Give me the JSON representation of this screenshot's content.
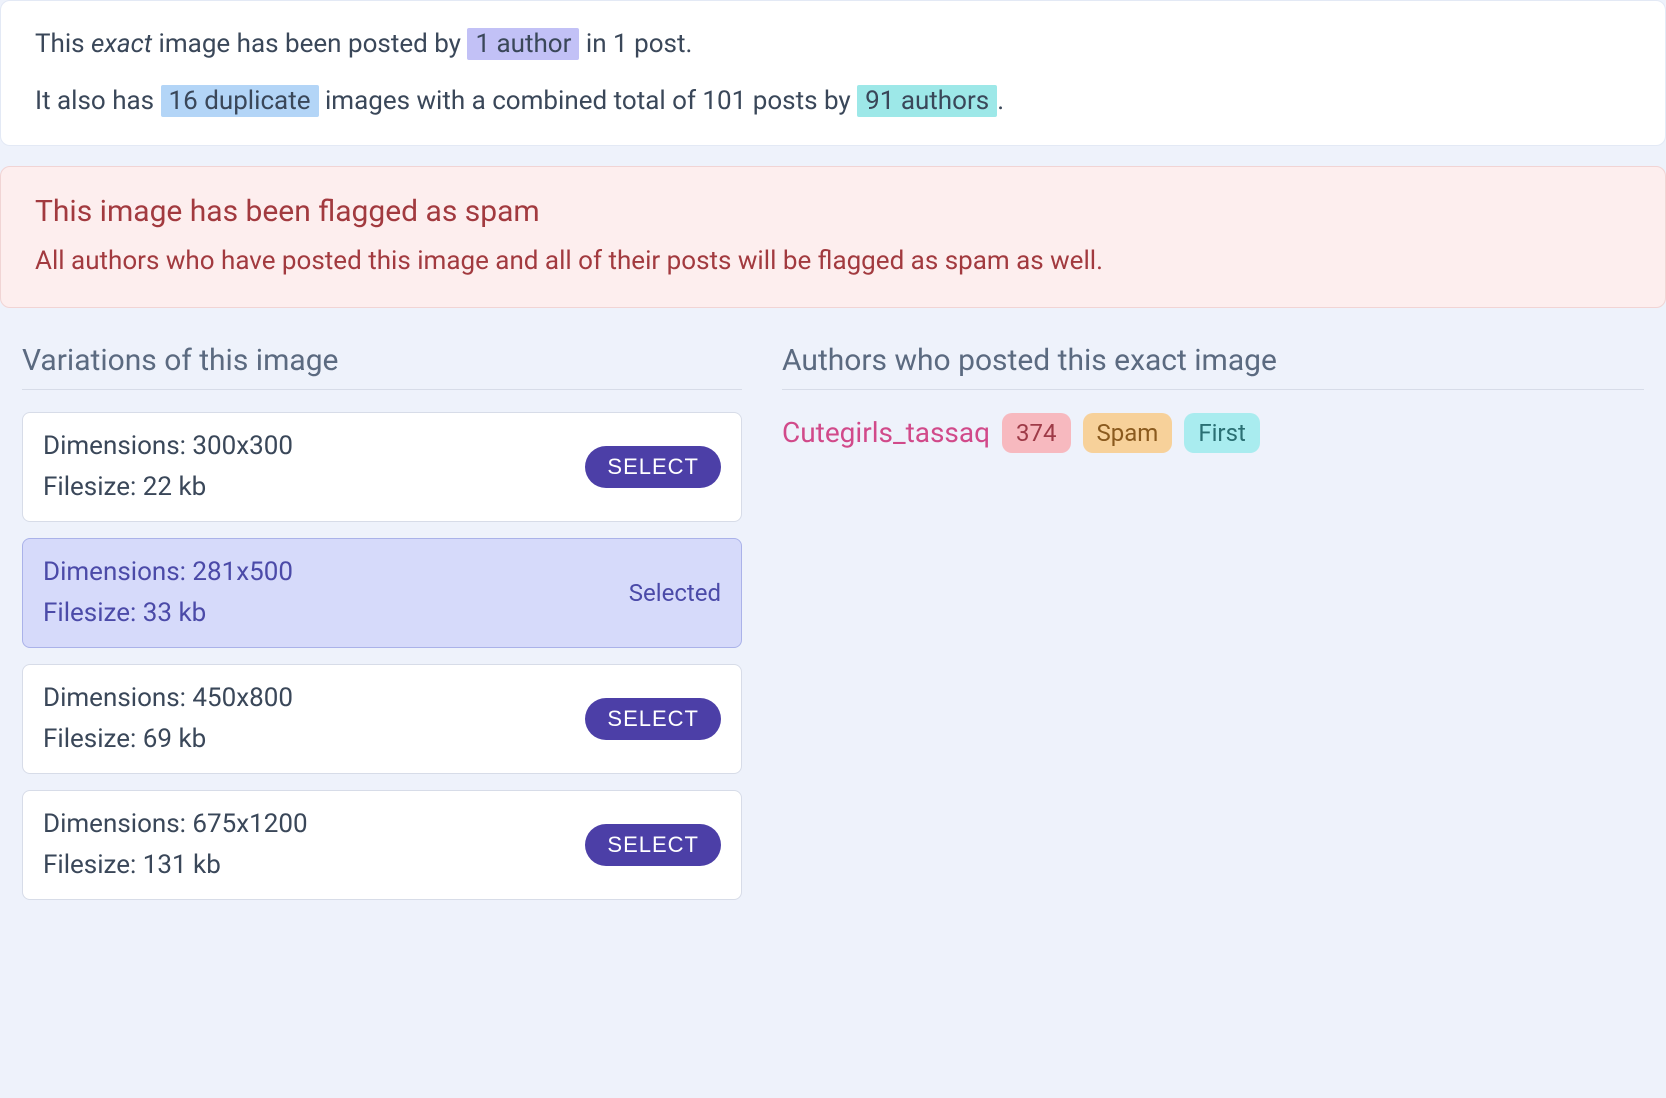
{
  "info": {
    "line1_prefix": "This ",
    "line1_exact": "exact",
    "line1_mid": " image has been posted by ",
    "line1_author_tag": "1 author",
    "line1_suffix": " in 1 post.",
    "line2_prefix": "It also has ",
    "line2_dup_tag": "16 duplicate",
    "line2_mid": " images with a combined total of 101 posts by ",
    "line2_auth_tag": "91 authors",
    "line2_suffix": "."
  },
  "alert": {
    "title": "This image has been flagged as spam",
    "body": "All authors who have posted this image and all of their posts will be flagged as spam as well."
  },
  "variations": {
    "heading": "Variations of this image",
    "select_label": "SELECT",
    "selected_label": "Selected",
    "items": [
      {
        "dimensions": "Dimensions: 300x300",
        "filesize": "Filesize: 22 kb",
        "selected": false
      },
      {
        "dimensions": "Dimensions: 281x500",
        "filesize": "Filesize: 33 kb",
        "selected": true
      },
      {
        "dimensions": "Dimensions: 450x800",
        "filesize": "Filesize: 69 kb",
        "selected": false
      },
      {
        "dimensions": "Dimensions: 675x1200",
        "filesize": "Filesize: 131 kb",
        "selected": false
      }
    ]
  },
  "authors": {
    "heading": "Authors who posted this exact image",
    "items": [
      {
        "name": "Cutegirls_tassaq",
        "count": "374",
        "spam_label": "Spam",
        "first_label": "First"
      }
    ]
  }
}
